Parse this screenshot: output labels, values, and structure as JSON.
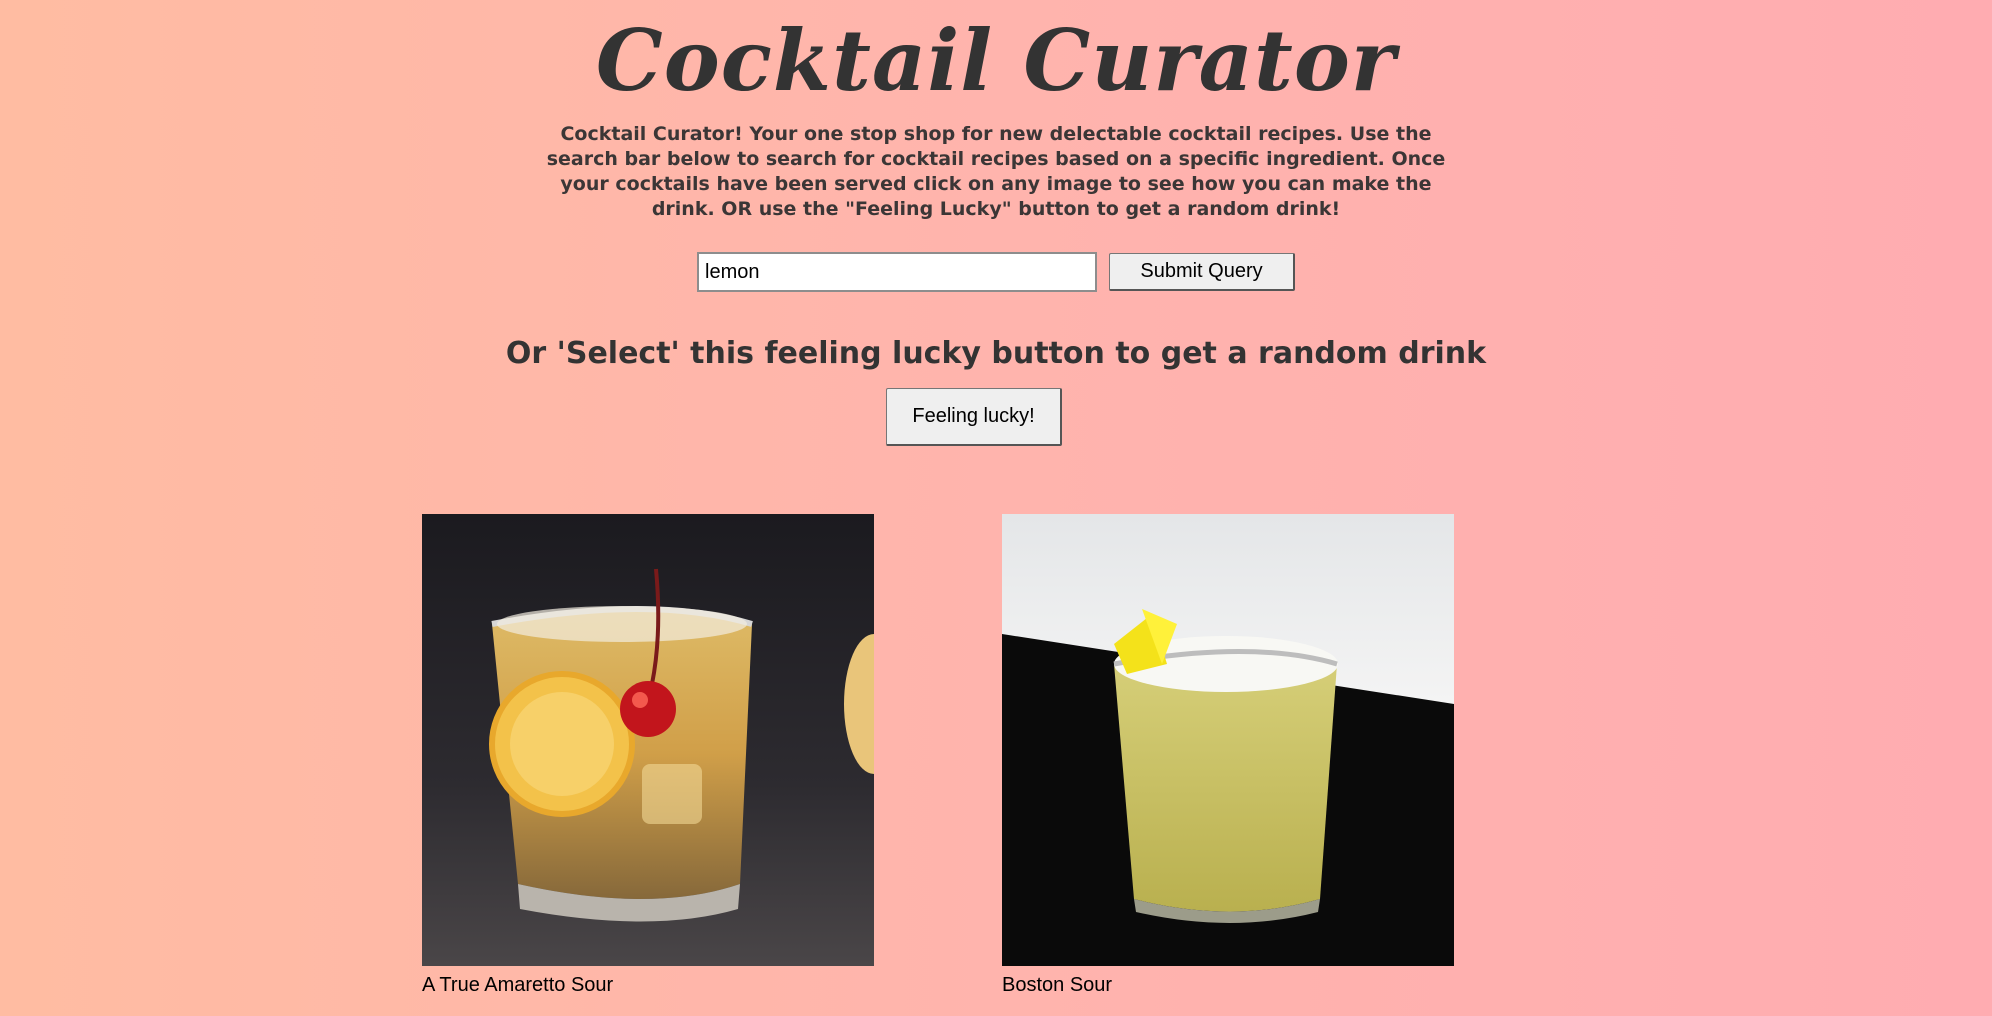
{
  "header": {
    "title": "Cocktail Curator",
    "intro": "Cocktail Curator! Your one stop shop for new delectable cocktail recipes. Use the search bar below to search for cocktail recipes based on a specific ingredient. Once your cocktails have been served click on any image to see how you can make the drink. OR use the \"Feeling Lucky\" button to get a random drink!"
  },
  "search": {
    "value": "lemon",
    "submit_label": "Submit Query"
  },
  "lucky": {
    "heading": "Or 'Select' this feeling lucky button to get a random drink",
    "button_label": "Feeling lucky!"
  },
  "results": [
    {
      "name": "A True Amaretto Sour"
    },
    {
      "name": "Boston Sour"
    }
  ],
  "colors": {
    "background_start": "#ffbca2",
    "background_end": "#ffacb1",
    "text": "#333333"
  }
}
